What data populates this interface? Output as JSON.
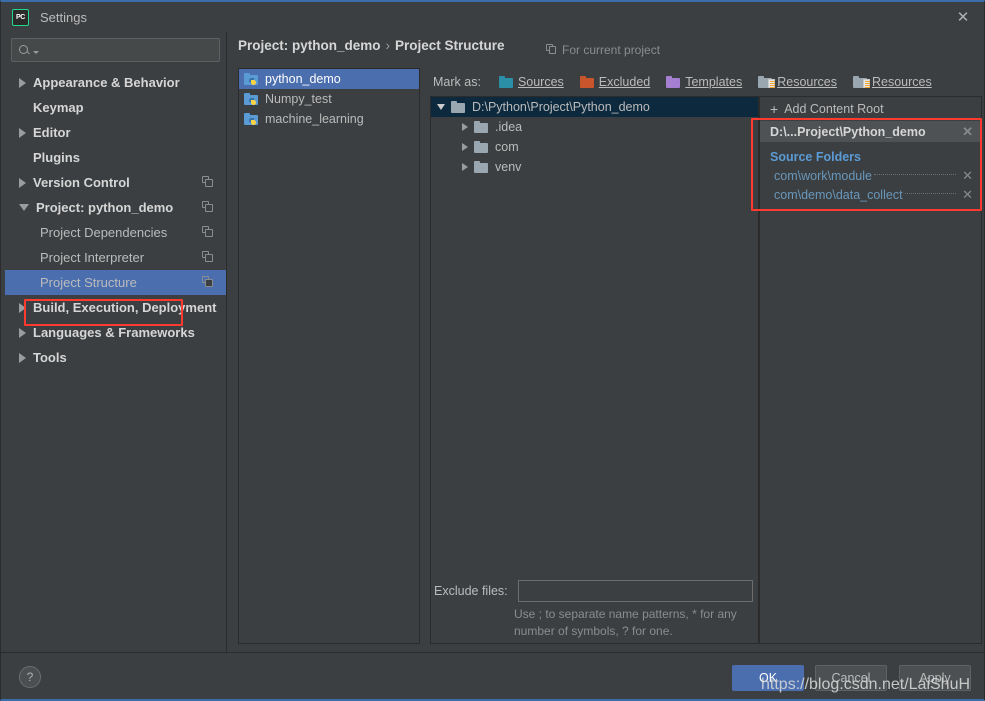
{
  "window": {
    "title": "Settings",
    "app_icon_text": "PC",
    "close_label": "✕"
  },
  "search": {
    "value": "",
    "placeholder": ""
  },
  "sidebar": {
    "items": [
      {
        "label": "Appearance & Behavior",
        "arrow": "right",
        "bold": true,
        "indent": false,
        "copy": false,
        "selected": false
      },
      {
        "label": "Keymap",
        "arrow": "none",
        "bold": true,
        "indent": false,
        "copy": false,
        "selected": false
      },
      {
        "label": "Editor",
        "arrow": "right",
        "bold": true,
        "indent": false,
        "copy": false,
        "selected": false
      },
      {
        "label": "Plugins",
        "arrow": "none",
        "bold": true,
        "indent": false,
        "copy": false,
        "selected": false
      },
      {
        "label": "Version Control",
        "arrow": "right",
        "bold": true,
        "indent": false,
        "copy": true,
        "selected": false
      },
      {
        "label": "Project: python_demo",
        "arrow": "down",
        "bold": true,
        "indent": false,
        "copy": true,
        "selected": false
      },
      {
        "label": "Project Dependencies",
        "arrow": "none",
        "bold": false,
        "indent": true,
        "copy": true,
        "selected": false
      },
      {
        "label": "Project Interpreter",
        "arrow": "none",
        "bold": false,
        "indent": true,
        "copy": true,
        "selected": false
      },
      {
        "label": "Project Structure",
        "arrow": "none",
        "bold": false,
        "indent": true,
        "copy": true,
        "selected": true
      },
      {
        "label": "Build, Execution, Deployment",
        "arrow": "right",
        "bold": true,
        "indent": false,
        "copy": false,
        "selected": false
      },
      {
        "label": "Languages & Frameworks",
        "arrow": "right",
        "bold": true,
        "indent": false,
        "copy": false,
        "selected": false
      },
      {
        "label": "Tools",
        "arrow": "right",
        "bold": true,
        "indent": false,
        "copy": false,
        "selected": false
      }
    ]
  },
  "header": {
    "breadcrumb_root": "Project: python_demo",
    "breadcrumb_sep": "›",
    "breadcrumb_leaf": "Project Structure",
    "for_current_project": "For current project"
  },
  "projects": {
    "items": [
      {
        "label": "python_demo",
        "selected": true
      },
      {
        "label": "Numpy_test",
        "selected": false
      },
      {
        "label": "machine_learning",
        "selected": false
      }
    ]
  },
  "mark_as": {
    "label": "Mark as:",
    "options": [
      {
        "label": "Sources",
        "color": "#2c8fa8",
        "type": "plain"
      },
      {
        "label": "Excluded",
        "color": "#c9552d",
        "type": "plain"
      },
      {
        "label": "Templates",
        "color": "#a57fd1",
        "type": "plain"
      },
      {
        "label": "Resources",
        "color": "#9aa7b0",
        "type": "lines"
      },
      {
        "label": "Resources",
        "color": "#9aa7b0",
        "type": "lines"
      }
    ]
  },
  "content_tree": {
    "nodes": [
      {
        "label": "D:\\Python\\Project\\Python_demo",
        "arrow": "down",
        "level": 0,
        "selected": true
      },
      {
        "label": ".idea",
        "arrow": "right",
        "level": 1,
        "selected": false
      },
      {
        "label": "com",
        "arrow": "right",
        "level": 1,
        "selected": false
      },
      {
        "label": "venv",
        "arrow": "right",
        "level": 1,
        "selected": false
      }
    ]
  },
  "exclude": {
    "label": "Exclude files:",
    "value": "",
    "placeholder": "",
    "hint": "Use ; to separate name patterns, * for any number of symbols, ? for one."
  },
  "detail": {
    "add_content_root": "Add Content Root",
    "add_icon": "+",
    "root_path": "D:\\...Project\\Python_demo",
    "root_remove": "✕",
    "source_folders_title": "Source Folders",
    "source_folders": [
      {
        "path": "com\\work\\module",
        "remove": "✕"
      },
      {
        "path": "com\\demo\\data_collect",
        "remove": "✕"
      }
    ]
  },
  "footer": {
    "help_label": "?",
    "ok_label": "OK",
    "cancel_label": "Cancel",
    "apply_label": "Apply"
  },
  "watermark": {
    "text": "https://blog.csdn.net/LaiShuH"
  },
  "colors": {
    "window_bg": "#3c3f41",
    "selection_blue": "#4b6eaf",
    "tree_selection": "#0d293e",
    "link_blue": "#6897bb",
    "accent_red": "#ff3b30",
    "text": "#bbbbbb"
  }
}
